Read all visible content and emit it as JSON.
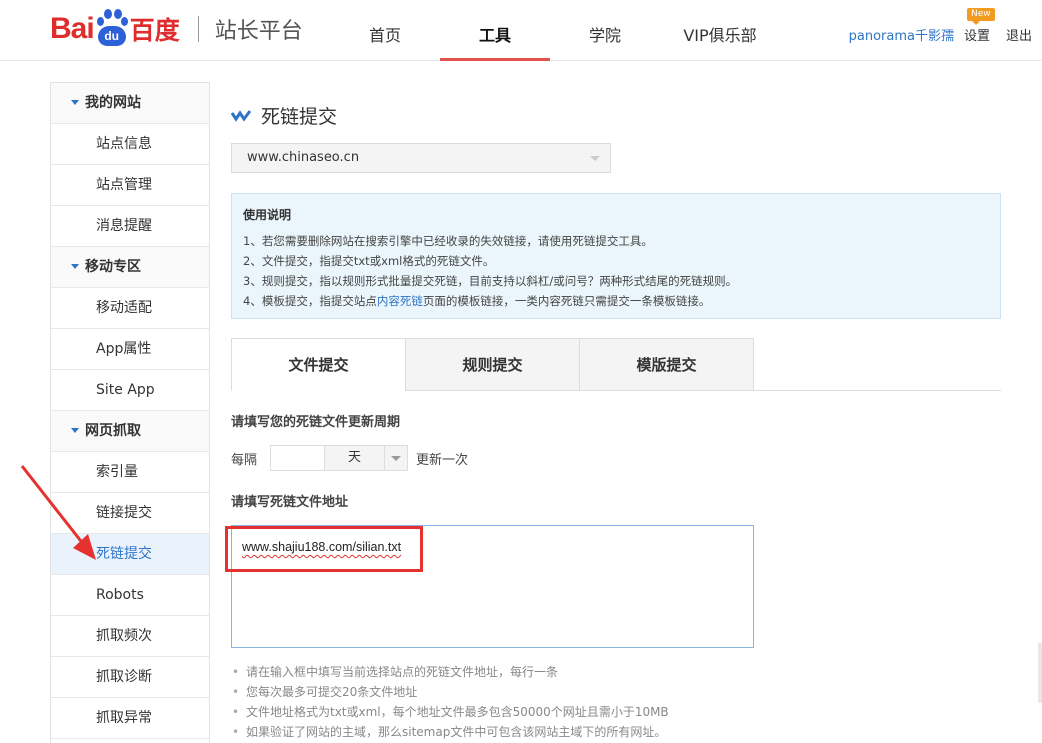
{
  "brand": {
    "logo_bai": "Bai",
    "logo_du": "du",
    "logo_baidu": "百度",
    "product": "站长平台",
    "accent_red": "#e2514e",
    "link_blue": "#2e75c8"
  },
  "nav": {
    "items": [
      {
        "label": "首页",
        "active": false
      },
      {
        "label": "工具",
        "active": true
      },
      {
        "label": "学院",
        "active": false
      },
      {
        "label": "VIP俱乐部",
        "active": false
      }
    ]
  },
  "user": {
    "name": "panorama千影孺",
    "settings": "设置",
    "new_badge": "New",
    "logout": "退出"
  },
  "sidebar": {
    "groups": [
      {
        "label": "我的网站",
        "items": [
          "站点信息",
          "站点管理",
          "消息提醒"
        ]
      },
      {
        "label": "移动专区",
        "items": [
          "移动适配",
          "App属性",
          "Site App"
        ]
      },
      {
        "label": "网页抓取",
        "items": [
          "索引量",
          "链接提交",
          "死链提交",
          "Robots",
          "抓取频次",
          "抓取诊断",
          "抓取异常"
        ]
      }
    ],
    "active_item": "死链提交"
  },
  "main": {
    "title": "死链提交",
    "site_select": {
      "value": "www.chinaseo.cn"
    },
    "usage": {
      "title": "使用说明",
      "line1": "1、若您需要删除网站在搜索引擎中已经收录的失效链接，请使用死链提交工具。",
      "line2": "2、文件提交，指提交txt或xml格式的死链文件。",
      "line3": "3、规则提交，指以规则形式批量提交死链，目前支持以斜杠/或问号？两种形式结尾的死链规则。",
      "line4_prefix": "4、模板提交，指提交站点",
      "line4_link": "内容死链",
      "line4_suffix": "页面的模板链接，一类内容死链只需提交一条模板链接。"
    },
    "tabs": [
      {
        "label": "文件提交",
        "active": true
      },
      {
        "label": "规则提交",
        "active": false
      },
      {
        "label": "模版提交",
        "active": false
      }
    ],
    "period": {
      "label": "请填写您的死链文件更新周期",
      "prefix": "每隔",
      "value": "",
      "unit": "天",
      "suffix": "更新一次"
    },
    "url_section": {
      "label": "请填写死链文件地址",
      "value": "www.shajiu188.com/silian.txt"
    },
    "tips": [
      "请在输入框中填写当前选择站点的死链文件地址，每行一条",
      "您每次最多可提交20条文件地址",
      "文件地址格式为txt或xml，每个地址文件最多包含50000个网址且需小于10MB",
      "如果验证了网站的主域，那么sitemap文件中可包含该网站主域下的所有网址。"
    ]
  },
  "annotation": {
    "arrow_color": "#e5322f",
    "highlight_color": "#e5322f"
  }
}
